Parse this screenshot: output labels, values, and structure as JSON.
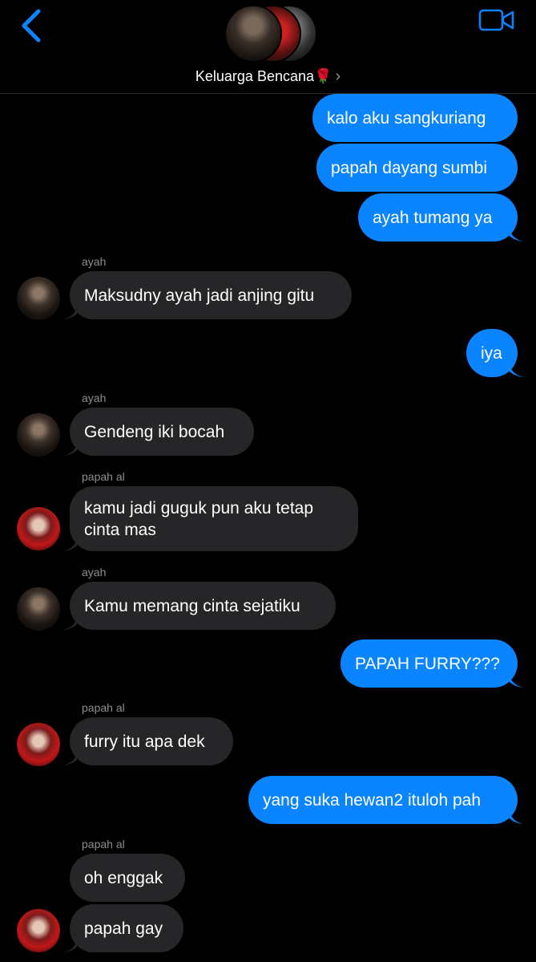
{
  "header": {
    "title": "Keluarga Bencana",
    "title_emoji": "🌹",
    "chevron": "›",
    "back_icon": "chevron-left",
    "video_icon": "video-camera",
    "accent": "#0a84ff"
  },
  "messages": [
    {
      "dir": "out",
      "text": "kalo aku sangkuriang"
    },
    {
      "dir": "out",
      "text": "papah dayang sumbi"
    },
    {
      "dir": "out",
      "text": "ayah tumang ya"
    },
    {
      "dir": "in",
      "sender": "ayah",
      "text": "Maksudny ayah jadi anjing gitu"
    },
    {
      "dir": "out",
      "text": "iya"
    },
    {
      "dir": "in",
      "sender": "ayah",
      "text": "Gendeng iki bocah"
    },
    {
      "dir": "in",
      "sender": "papah al",
      "text": "kamu jadi guguk pun aku tetap cinta mas"
    },
    {
      "dir": "in",
      "sender": "ayah",
      "text": "Kamu memang cinta sejatiku"
    },
    {
      "dir": "out",
      "text": "PAPAH FURRY???"
    },
    {
      "dir": "in",
      "sender": "papah al",
      "text": "furry itu apa dek"
    },
    {
      "dir": "out",
      "text": "yang suka hewan2 ituloh pah"
    },
    {
      "dir": "in",
      "sender": "papah al",
      "text": "oh enggak"
    },
    {
      "dir": "in",
      "text": "papah gay"
    }
  ],
  "colors": {
    "outgoing": "#0a84ff",
    "incoming": "#262628",
    "background": "#000000",
    "sender_label": "#8e8e93"
  }
}
